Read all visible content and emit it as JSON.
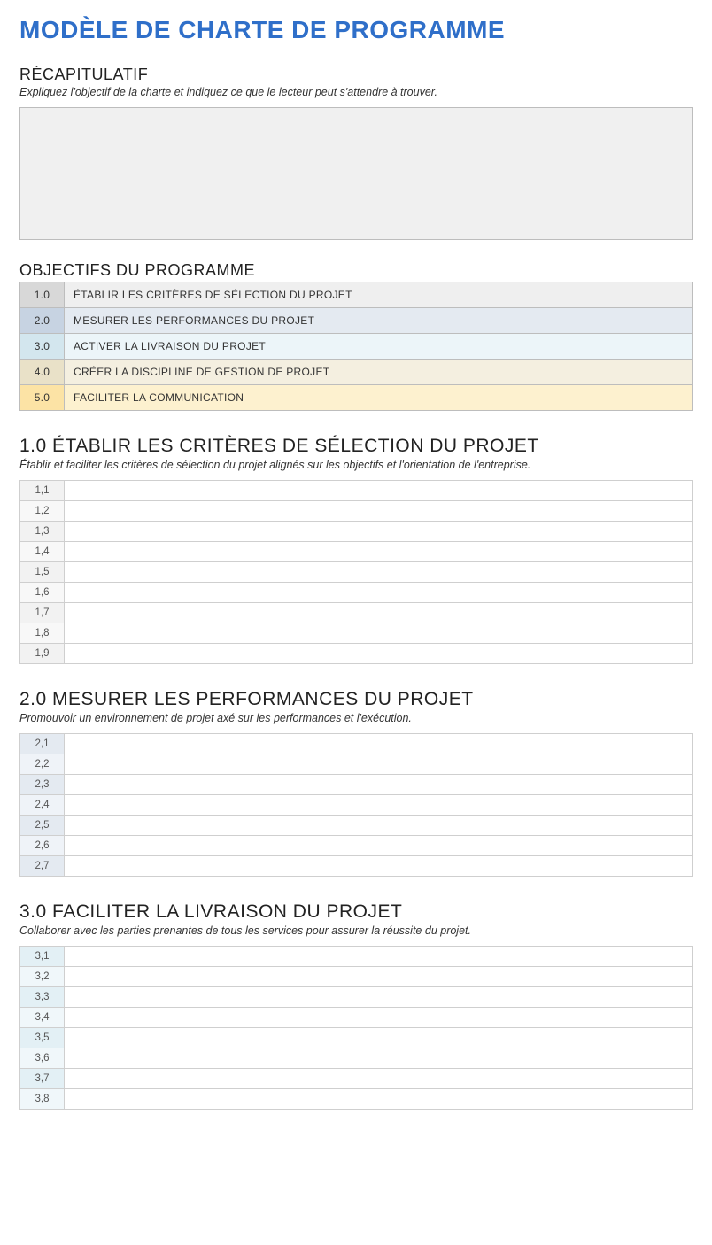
{
  "title": "MODÈLE DE CHARTE DE PROGRAMME",
  "recap": {
    "heading": "RÉCAPITULATIF",
    "desc": "Expliquez l'objectif de la charte et indiquez ce que le lecteur peut s'attendre à trouver."
  },
  "objectives": {
    "heading": "OBJECTIFS DU PROGRAMME",
    "rows": [
      {
        "num": "1.0",
        "label": "ÉTABLIR LES CRITÈRES DE SÉLECTION DU PROJET"
      },
      {
        "num": "2.0",
        "label": "MESURER LES PERFORMANCES DU PROJET"
      },
      {
        "num": "3.0",
        "label": "ACTIVER LA LIVRAISON DU PROJET"
      },
      {
        "num": "4.0",
        "label": "CRÉER LA DISCIPLINE DE GESTION DE PROJET"
      },
      {
        "num": "5.0",
        "label": "FACILITER LA COMMUNICATION"
      }
    ]
  },
  "section1": {
    "heading": "1.0 ÉTABLIR LES CRITÈRES DE SÉLECTION DU PROJET",
    "desc": "Établir et faciliter les critères de sélection du projet alignés sur les objectifs et l'orientation de l'entreprise.",
    "rows": [
      "1,1",
      "1,2",
      "1,3",
      "1,4",
      "1,5",
      "1,6",
      "1,7",
      "1,8",
      "1,9"
    ]
  },
  "section2": {
    "heading": "2.0 MESURER LES PERFORMANCES DU PROJET",
    "desc": "Promouvoir un environnement de projet axé sur les performances et l'exécution.",
    "rows": [
      "2,1",
      "2,2",
      "2,3",
      "2,4",
      "2,5",
      "2,6",
      "2,7"
    ]
  },
  "section3": {
    "heading": "3.0 FACILITER LA LIVRAISON DU PROJET",
    "desc": "Collaborer avec les parties prenantes de tous les services pour assurer la réussite du projet.",
    "rows": [
      "3,1",
      "3,2",
      "3,3",
      "3,4",
      "3,5",
      "3,6",
      "3,7",
      "3,8"
    ]
  }
}
